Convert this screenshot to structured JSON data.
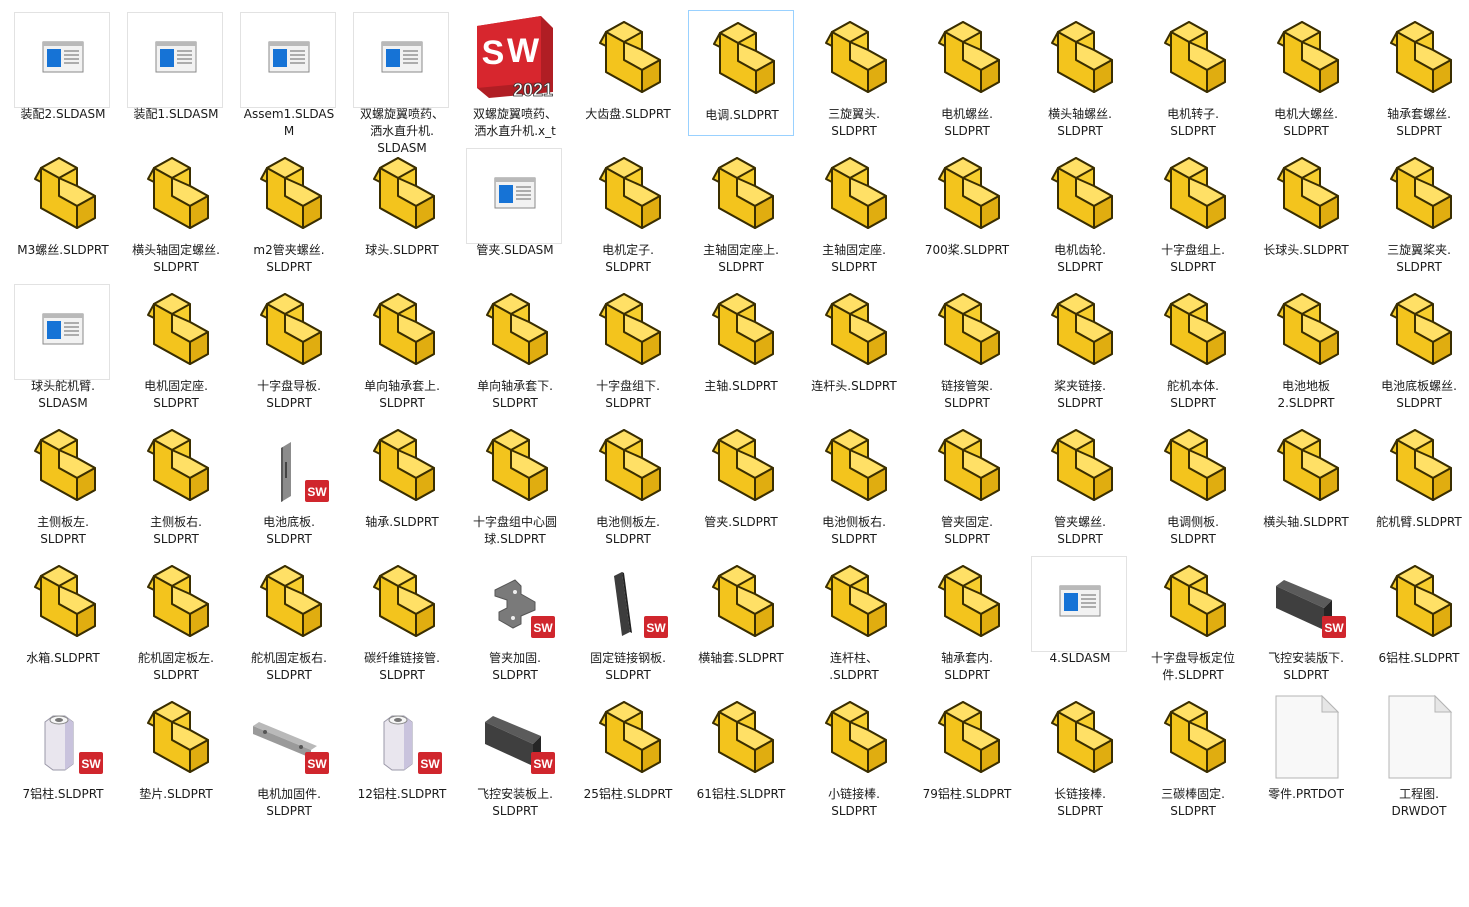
{
  "window": {
    "view": "large-icons"
  },
  "files": [
    {
      "name": "装配2.SLDASM",
      "icon": "assembly-thumb-icon"
    },
    {
      "name": "装配1.SLDASM",
      "icon": "assembly-thumb-icon"
    },
    {
      "name": "Assem1.SLDAS\nM",
      "icon": "assembly-thumb-icon"
    },
    {
      "name": "双螺旋翼喷药、\n洒水直升机.\nSLDASM",
      "icon": "assembly-thumb-icon"
    },
    {
      "name": "双螺旋翼喷药、\n洒水直升机.x_t",
      "icon": "solidworks-2021-icon",
      "icon_text": "2021"
    },
    {
      "name": "大齿盘.SLDPRT",
      "icon": "part-block-icon"
    },
    {
      "name": "电调.SLDPRT",
      "icon": "part-block-icon",
      "selected": true
    },
    {
      "name": "三旋翼头.\nSLDPRT",
      "icon": "part-block-icon"
    },
    {
      "name": "电机螺丝.\nSLDPRT",
      "icon": "part-block-icon"
    },
    {
      "name": "横头轴螺丝.\nSLDPRT",
      "icon": "part-block-icon"
    },
    {
      "name": "电机转子.\nSLDPRT",
      "icon": "part-block-icon"
    },
    {
      "name": "电机大螺丝.\nSLDPRT",
      "icon": "part-block-icon"
    },
    {
      "name": "轴承套螺丝.\nSLDPRT",
      "icon": "part-block-icon"
    },
    {
      "name": "M3螺丝.SLDPRT",
      "icon": "part-block-icon"
    },
    {
      "name": "横头轴固定螺丝.\nSLDPRT",
      "icon": "part-block-icon"
    },
    {
      "name": "m2管夹螺丝.\nSLDPRT",
      "icon": "part-block-icon"
    },
    {
      "name": "球头.SLDPRT",
      "icon": "part-block-icon"
    },
    {
      "name": "管夹.SLDASM",
      "icon": "assembly-thumb-icon"
    },
    {
      "name": "电机定子.\nSLDPRT",
      "icon": "part-block-icon"
    },
    {
      "name": "主轴固定座上.\nSLDPRT",
      "icon": "part-block-icon"
    },
    {
      "name": "主轴固定座.\nSLDPRT",
      "icon": "part-block-icon"
    },
    {
      "name": "700桨.SLDPRT",
      "icon": "part-block-icon"
    },
    {
      "name": "电机齿轮.\nSLDPRT",
      "icon": "part-block-icon"
    },
    {
      "name": "十字盘组上.\nSLDPRT",
      "icon": "part-block-icon"
    },
    {
      "name": "长球头.SLDPRT",
      "icon": "part-block-icon"
    },
    {
      "name": "三旋翼桨夹.\nSLDPRT",
      "icon": "part-block-icon"
    },
    {
      "name": "球头舵机臂.\nSLDASM",
      "icon": "assembly-thumb-icon"
    },
    {
      "name": "电机固定座.\nSLDPRT",
      "icon": "part-block-icon"
    },
    {
      "name": "十字盘导板.\nSLDPRT",
      "icon": "part-block-icon"
    },
    {
      "name": "单向轴承套上.\nSLDPRT",
      "icon": "part-block-icon"
    },
    {
      "name": "单向轴承套下.\nSLDPRT",
      "icon": "part-block-icon"
    },
    {
      "name": "十字盘组下.\nSLDPRT",
      "icon": "part-block-icon"
    },
    {
      "name": "主轴.SLDPRT",
      "icon": "part-block-icon"
    },
    {
      "name": "连杆头.SLDPRT",
      "icon": "part-block-icon"
    },
    {
      "name": "链接管架.\nSLDPRT",
      "icon": "part-block-icon"
    },
    {
      "name": "桨夹链接.\nSLDPRT",
      "icon": "part-block-icon"
    },
    {
      "name": "舵机本体.\nSLDPRT",
      "icon": "part-block-icon"
    },
    {
      "name": "电池地板\n2.SLDPRT",
      "icon": "part-block-icon"
    },
    {
      "name": "电池底板螺丝.\nSLDPRT",
      "icon": "part-block-icon"
    },
    {
      "name": "主侧板左.\nSLDPRT",
      "icon": "part-block-icon"
    },
    {
      "name": "主侧板右.\nSLDPRT",
      "icon": "part-block-icon"
    },
    {
      "name": "电池底板.\nSLDPRT",
      "icon": "thin-plate-thumb-icon"
    },
    {
      "name": "轴承.SLDPRT",
      "icon": "part-block-icon"
    },
    {
      "name": "十字盘组中心圆\n球.SLDPRT",
      "icon": "part-block-icon"
    },
    {
      "name": "电池侧板左.\nSLDPRT",
      "icon": "part-block-icon"
    },
    {
      "name": "管夹.SLDPRT",
      "icon": "part-block-icon"
    },
    {
      "name": "电池侧板右.\nSLDPRT",
      "icon": "part-block-icon"
    },
    {
      "name": "管夹固定.\nSLDPRT",
      "icon": "part-block-icon"
    },
    {
      "name": "管夹螺丝.\nSLDPRT",
      "icon": "part-block-icon"
    },
    {
      "name": "电调侧板.\nSLDPRT",
      "icon": "part-block-icon"
    },
    {
      "name": "横头轴.SLDPRT",
      "icon": "part-block-icon"
    },
    {
      "name": "舵机臂.SLDPRT",
      "icon": "part-block-icon"
    },
    {
      "name": "水箱.SLDPRT",
      "icon": "part-block-icon"
    },
    {
      "name": "舵机固定板左.\nSLDPRT",
      "icon": "part-block-icon"
    },
    {
      "name": "舵机固定板右.\nSLDPRT",
      "icon": "part-block-icon"
    },
    {
      "name": "碳纤维链接管.\nSLDPRT",
      "icon": "part-block-icon"
    },
    {
      "name": "管夹加固.\nSLDPRT",
      "icon": "bracket-thumb-icon"
    },
    {
      "name": "固定链接钢板.\nSLDPRT",
      "icon": "dark-plate-thumb-icon"
    },
    {
      "name": "横轴套.SLDPRT",
      "icon": "part-block-icon"
    },
    {
      "name": "连杆柱、\n.SLDPRT",
      "icon": "part-block-icon"
    },
    {
      "name": "轴承套内.\nSLDPRT",
      "icon": "part-block-icon"
    },
    {
      "name": "4.SLDASM",
      "icon": "assembly-thumb-icon"
    },
    {
      "name": "十字盘导板定位\n件.SLDPRT",
      "icon": "part-block-icon"
    },
    {
      "name": "飞控安装版下.\nSLDPRT",
      "icon": "black-board-thumb-icon"
    },
    {
      "name": "6铝柱.SLDPRT",
      "icon": "part-block-icon"
    },
    {
      "name": "7铝柱.SLDPRT",
      "icon": "standoff-thumb-icon"
    },
    {
      "name": "垫片.SLDPRT",
      "icon": "part-block-icon"
    },
    {
      "name": "电机加固件.\nSLDPRT",
      "icon": "bar-thumb-icon"
    },
    {
      "name": "12铝柱.SLDPRT",
      "icon": "standoff-thumb-icon"
    },
    {
      "name": "飞控安装板上.\nSLDPRT",
      "icon": "black-board-thumb-icon"
    },
    {
      "name": "25铝柱.SLDPRT",
      "icon": "part-block-icon"
    },
    {
      "name": "61铝柱.SLDPRT",
      "icon": "part-block-icon"
    },
    {
      "name": "小链接棒.\nSLDPRT",
      "icon": "part-block-icon"
    },
    {
      "name": "79铝柱.SLDPRT",
      "icon": "part-block-icon"
    },
    {
      "name": "长链接棒.\nSLDPRT",
      "icon": "part-block-icon"
    },
    {
      "name": "三碳棒固定.\nSLDPRT",
      "icon": "part-block-icon"
    },
    {
      "name": "零件.PRTDOT",
      "icon": "blank-document-icon"
    },
    {
      "name": "工程图.\nDRWDOT",
      "icon": "blank-document-icon"
    }
  ],
  "colors": {
    "part_yellow": "#f7ce2d",
    "selection_border": "#99d1ff",
    "sw_red": "#d0262d"
  }
}
